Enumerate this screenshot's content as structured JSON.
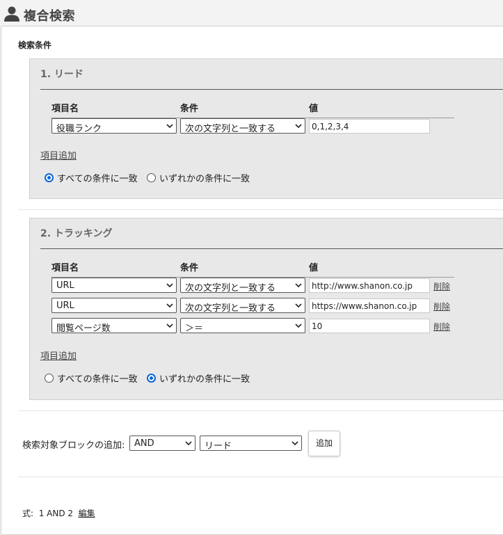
{
  "header": {
    "title": "複合検索",
    "icon": "person-icon"
  },
  "conditions": {
    "title": "検索条件"
  },
  "columns": {
    "item": "項目名",
    "condition": "条件",
    "value": "値"
  },
  "blocks": [
    {
      "title": "1. リード",
      "rows": [
        {
          "item": "役職ランク",
          "condition": "次の文字列と一致する",
          "value": "0,1,2,3,4"
        }
      ],
      "add_label": "項目追加",
      "match_all_label": "すべての条件に一致",
      "match_any_label": "いずれかの条件に一致",
      "match_mode": "all"
    },
    {
      "title": "2. トラッキング",
      "rows": [
        {
          "item": "URL",
          "condition": "次の文字列と一致する",
          "value": "http://www.shanon.co.jp",
          "delete_label": "削除"
        },
        {
          "item": "URL",
          "condition": "次の文字列と一致する",
          "value": "https://www.shanon.co.jp",
          "delete_label": "削除"
        },
        {
          "item": "閲覧ページ数",
          "condition": "＞＝",
          "value": "10",
          "delete_label": "削除"
        }
      ],
      "add_label": "項目追加",
      "match_all_label": "すべての条件に一致",
      "match_any_label": "いずれかの条件に一致",
      "match_mode": "any"
    }
  ],
  "add_block": {
    "label": "検索対象ブロックの追加:",
    "operator": "AND",
    "target": "リード",
    "button": "追加"
  },
  "formula": {
    "label": "式:",
    "value": "1 AND 2",
    "edit": "編集"
  },
  "colors": {
    "accent": "#0a66d8",
    "block_bg": "#e8e8e8"
  }
}
